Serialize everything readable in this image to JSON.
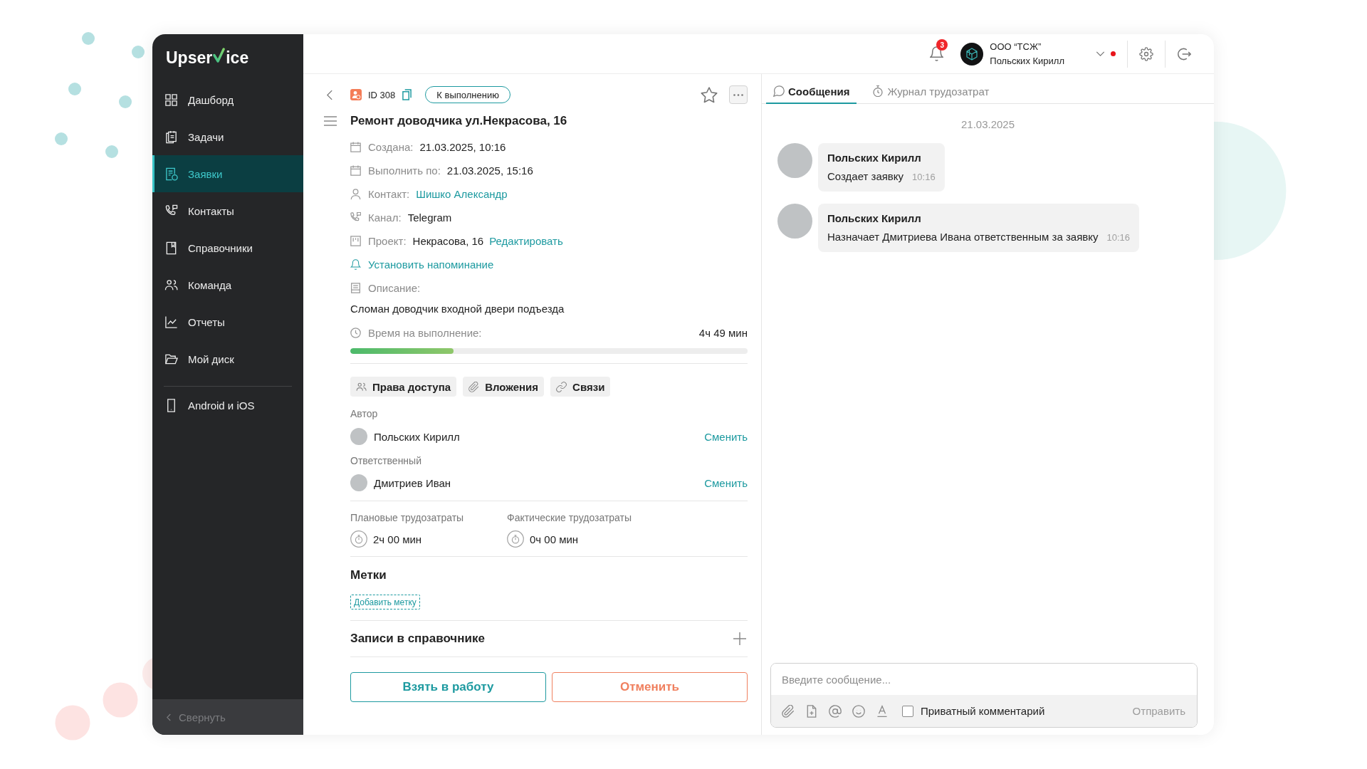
{
  "sidebar": {
    "logo": {
      "before": "Upser",
      "after": "ice"
    },
    "items": [
      {
        "label": "Дашборд",
        "selected": false
      },
      {
        "label": "Задачи",
        "selected": false
      },
      {
        "label": "Заявки",
        "selected": true
      },
      {
        "label": "Контакты",
        "selected": false
      },
      {
        "label": "Справочники",
        "selected": false
      },
      {
        "label": "Команда",
        "selected": false
      },
      {
        "label": "Отчеты",
        "selected": false
      },
      {
        "label": "Мой диск",
        "selected": false
      }
    ],
    "apps_item": {
      "label": "Android и iOS"
    },
    "collapse": "Свернуть"
  },
  "header": {
    "notifications": {
      "count": "3"
    },
    "account": {
      "company": "ООО “ТСЖ”",
      "user": "Польских Кирилл",
      "indicator": true
    }
  },
  "ticket": {
    "id": "ID 308",
    "status": "К выполнению",
    "favorite": false,
    "title": "Ремонт доводчика ул.Некрасова, 16",
    "fields": [
      {
        "kind": "text",
        "label": "Создана:",
        "value": "21.03.2025, 10:16"
      },
      {
        "kind": "text",
        "label": "Выполнить по:",
        "value": "21.03.2025, 15:16"
      },
      {
        "kind": "link",
        "label": "Контакт:",
        "value": "Шишко Александр"
      },
      {
        "kind": "text",
        "label": "Канал:",
        "value": "Telegram"
      },
      {
        "kind": "text",
        "label": "Проект:",
        "value": "Некрасова, 16",
        "action": "Редактировать"
      }
    ],
    "reminder": "Установить напоминание",
    "description": {
      "label": "Описание:",
      "text": "Сломан доводчик входной двери подъезда"
    },
    "time": {
      "label": "Время на выполнение:",
      "reading": "4ч 49 мин",
      "level": 0.26
    },
    "sections": [
      "Права доступа",
      "Вложения",
      "Связи"
    ],
    "people": [
      {
        "role": "Автор",
        "name": "Польских Кирилл",
        "action": "Сменить"
      },
      {
        "role": "Ответственный",
        "name": "Дмитриев Иван",
        "action": "Сменить"
      }
    ],
    "effort": [
      {
        "label": "Плановые трудозатраты",
        "value": "2ч 00 мин"
      },
      {
        "label": "Фактические трудозатраты",
        "value": "0ч 00 мин"
      }
    ],
    "tags": {
      "title": "Метки",
      "add_label": "Добавить метку"
    },
    "directory": {
      "title": "Записи в справочнике"
    },
    "buttons": [
      {
        "kind": "primary",
        "label": "Взять в работу"
      },
      {
        "kind": "cancel",
        "label": "Отменить"
      }
    ]
  },
  "chat": {
    "tabs": [
      {
        "label": "Сообщения",
        "selected": true
      },
      {
        "label": "Журнал трудозатрат",
        "selected": false
      }
    ],
    "date": "21.03.2025",
    "messages": [
      {
        "author": "Польских Кирилл",
        "text": "Создает заявку",
        "time": "10:16"
      },
      {
        "author": "Польских Кирилл",
        "text": "Назначает Дмитриева Ивана ответственным за заявку",
        "time": "10:16"
      }
    ],
    "composer": {
      "placeholder": "Введите сообщение...",
      "private": {
        "label": "Приватный комментарий",
        "checked": false
      },
      "send": {
        "label": "Отправить",
        "disabled": true
      }
    }
  }
}
